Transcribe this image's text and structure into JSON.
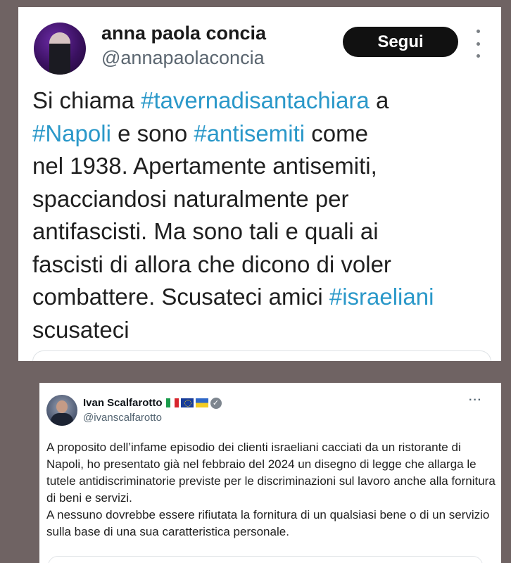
{
  "post1": {
    "name": "anna paola concia",
    "handle": "@annapaolaconcia",
    "follow_label": "Segui",
    "lines": [
      [
        {
          "t": "Si chiama "
        },
        {
          "t": "#tavernadisantachiara",
          "tag": true
        },
        {
          "t": " a"
        }
      ],
      [
        {
          "t": "#Napoli",
          "tag": true
        },
        {
          "t": " e sono "
        },
        {
          "t": "#antisemiti",
          "tag": true
        },
        {
          "t": " come"
        }
      ],
      [
        {
          "t": "nel 1938. Apertamente antisemiti,"
        }
      ],
      [
        {
          "t": "spacciandosi naturalmente per"
        }
      ],
      [
        {
          "t": "antifascisti. Ma sono tali e quali ai"
        }
      ],
      [
        {
          "t": "fascisti di allora che dicono di voler"
        }
      ],
      [
        {
          "t": "combattere. Scusateci amici "
        },
        {
          "t": "#israeliani",
          "tag": true
        }
      ],
      [
        {
          "t": "scusateci"
        }
      ]
    ]
  },
  "post2": {
    "name": "Ivan Scalfarotto",
    "handle": "@ivanscalfarotto",
    "more_label": "···",
    "verified_icon": "✓",
    "paragraphs": [
      "A proposito dell’infame episodio dei clienti israeliani cacciati da un ristorante di Napoli, ho presentato già nel febbraio del 2024 un disegno di legge che allarga le tutele antidiscriminatorie previste per le discriminazioni sul lavoro anche alla fornitura di beni e servizi.",
      "A nessuno dovrebbe essere rifiutata la fornitura di un qualsiasi bene o di un servizio sulla base di una sua caratteristica personale."
    ]
  },
  "colors": {
    "hashtag": "#2a98c9",
    "background": "#6f6363",
    "button": "#111111"
  }
}
